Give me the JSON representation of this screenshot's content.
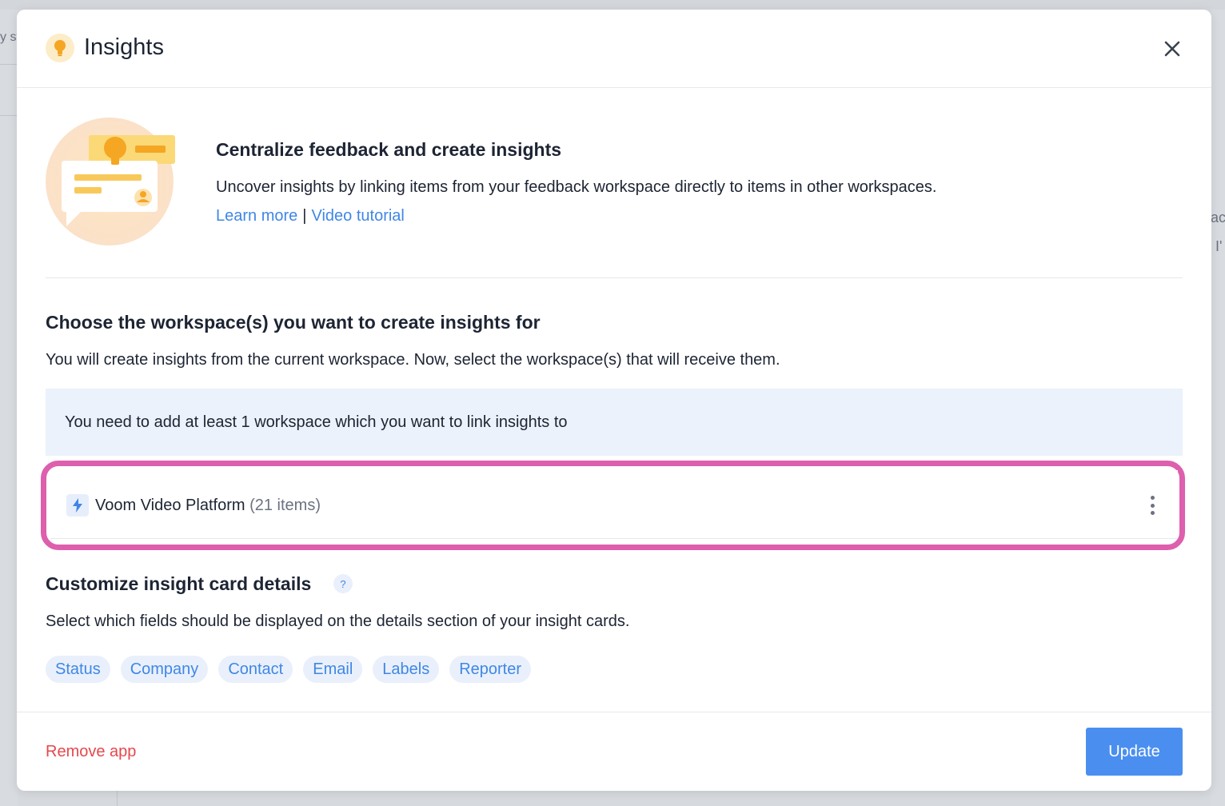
{
  "background": {
    "left_text": "y st",
    "right_text_1": "ac",
    "right_text_2": ". I'"
  },
  "modal": {
    "title": "Insights",
    "header_icon": "lightbulb-icon",
    "close_icon": "close-icon"
  },
  "hero": {
    "title": "Centralize feedback and create insights",
    "description": "Uncover insights by linking items from your feedback workspace directly to items in other workspaces.",
    "link_learn_more": "Learn more",
    "separator": "|",
    "link_video_tutorial": "Video tutorial"
  },
  "workspaces": {
    "title": "Choose the workspace(s) you want to create insights for",
    "description": "You will create insights from the current workspace. Now, select the workspace(s) that will receive them.",
    "info_message": "You need to add at least 1 workspace which you want to link insights to",
    "items": [
      {
        "name": "Voom Video Platform",
        "count": "(21 items)",
        "icon": "lightning-bolt-icon",
        "menu_icon": "more-vertical-icon"
      }
    ]
  },
  "customize": {
    "title": "Customize insight card details",
    "help_label": "?",
    "description": "Select which fields should be displayed on the details section of your insight cards.",
    "fields": [
      "Status",
      "Company",
      "Contact",
      "Email",
      "Labels",
      "Reporter"
    ]
  },
  "footer": {
    "remove_label": "Remove app",
    "update_label": "Update"
  },
  "colors": {
    "accent": "#4a8ff0",
    "link": "#3f87e6",
    "danger": "#e5484d",
    "highlight_border": "#dd5fad",
    "info_bg": "#ebf2fb"
  }
}
